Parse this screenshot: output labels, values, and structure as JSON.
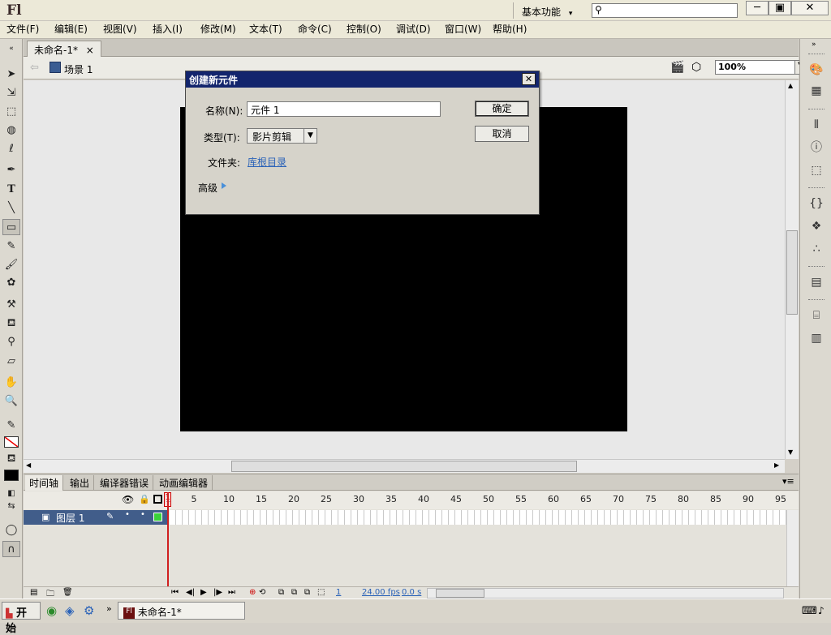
{
  "app": {
    "logo": "Fl",
    "workspace": "基本功能",
    "search_placeholder": "",
    "window_buttons": [
      "─",
      "▣",
      "✕"
    ]
  },
  "menu": [
    "文件(F)",
    "编辑(E)",
    "视图(V)",
    "插入(I)",
    "修改(M)",
    "文本(T)",
    "命令(C)",
    "控制(O)",
    "调试(D)",
    "窗口(W)",
    "帮助(H)"
  ],
  "document": {
    "tab_label": "未命名-1*",
    "tab_close": "×",
    "scene": "场景 1",
    "zoom": "100%"
  },
  "dialog": {
    "title": "创建新元件",
    "close": "✕",
    "name_label": "名称(N):",
    "name_value": "元件 1",
    "type_label": "类型(T):",
    "type_value": "影片剪辑",
    "folder_label": "文件夹:",
    "folder_link": "库根目录",
    "advanced": "高级",
    "ok": "确定",
    "cancel": "取消"
  },
  "timeline": {
    "tabs": [
      "时间轴",
      "输出",
      "编译器错误",
      "动画编辑器"
    ],
    "frame_numbers": [
      "1",
      "5",
      "10",
      "15",
      "20",
      "25",
      "30",
      "35",
      "40",
      "45",
      "50",
      "55",
      "60",
      "65",
      "70",
      "75",
      "80",
      "85",
      "90",
      "95"
    ],
    "layer_name": "图层 1",
    "current_frame": "1",
    "fps": "24.00 fps",
    "time": "0.0 s"
  },
  "taskbar": {
    "start": "开始",
    "item": "未命名-1*"
  },
  "colors": {
    "dialog_title": "#13256d",
    "layer_selected": "#415d8a",
    "stage": "#000000",
    "link": "#2a62b8"
  }
}
